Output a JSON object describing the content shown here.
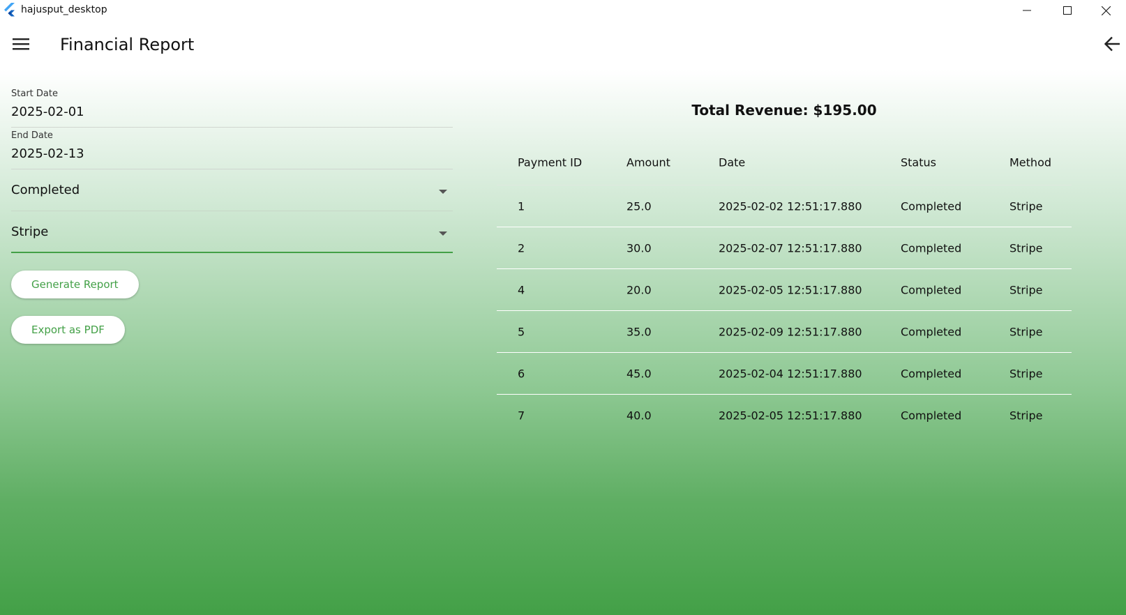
{
  "window": {
    "title": "hajusput_desktop",
    "controls": [
      "minimize-icon",
      "maximize-icon",
      "close-icon"
    ]
  },
  "appbar": {
    "title": "Financial Report",
    "menu_icon": "hamburger-menu-icon",
    "back_icon": "arrow-back-icon"
  },
  "form": {
    "start_date": {
      "label": "Start Date",
      "value": "2025-02-01"
    },
    "end_date": {
      "label": "End Date",
      "value": "2025-02-13"
    },
    "status_select": {
      "value": "Completed"
    },
    "method_select": {
      "value": "Stripe"
    },
    "generate_label": "Generate Report",
    "export_label": "Export as PDF"
  },
  "report": {
    "total_revenue": "Total Revenue: $195.00",
    "columns": [
      "Payment ID",
      "Amount",
      "Date",
      "Status",
      "Method"
    ],
    "rows": [
      [
        "1",
        "25.0",
        "2025-02-02 12:51:17.880",
        "Completed",
        "Stripe"
      ],
      [
        "2",
        "30.0",
        "2025-02-07 12:51:17.880",
        "Completed",
        "Stripe"
      ],
      [
        "4",
        "20.0",
        "2025-02-05 12:51:17.880",
        "Completed",
        "Stripe"
      ],
      [
        "5",
        "35.0",
        "2025-02-09 12:51:17.880",
        "Completed",
        "Stripe"
      ],
      [
        "6",
        "45.0",
        "2025-02-04 12:51:17.880",
        "Completed",
        "Stripe"
      ],
      [
        "7",
        "40.0",
        "2025-02-05 12:51:17.880",
        "Completed",
        "Stripe"
      ]
    ]
  },
  "colors": {
    "accent": "#43a047",
    "gradient_top": "#ffffff",
    "gradient_bottom": "#43a047"
  }
}
